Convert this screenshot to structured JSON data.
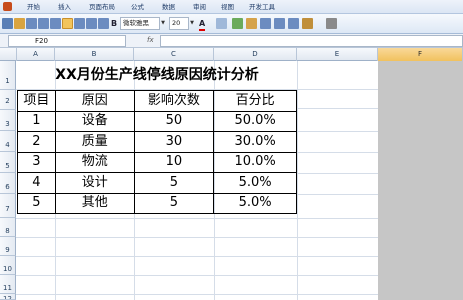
{
  "ribbon": {
    "tabs": [
      "开始",
      "插入",
      "页面布局",
      "公式",
      "数据",
      "审阅",
      "视图",
      "开发工具"
    ]
  },
  "toolbar": {
    "bold_label": "B",
    "font_name": "微软雅黑",
    "font_size": "20",
    "font_color_label": "A"
  },
  "formula_bar": {
    "cell_reference": "F20",
    "fx_label": "fx",
    "formula_value": ""
  },
  "sheet": {
    "columns": [
      "A",
      "B",
      "C",
      "D",
      "E",
      "F"
    ],
    "rows": [
      "1",
      "2",
      "3",
      "4",
      "5",
      "6",
      "7",
      "8",
      "9",
      "10",
      "11",
      "12"
    ],
    "selected_column": "F"
  },
  "table": {
    "title": "XX月份生产线停线原因统计分析",
    "headers": [
      "项目",
      "原因",
      "影响次数",
      "百分比"
    ],
    "rows": [
      [
        "1",
        "设备",
        "50",
        "50.0%"
      ],
      [
        "2",
        "质量",
        "30",
        "30.0%"
      ],
      [
        "3",
        "物流",
        "10",
        "10.0%"
      ],
      [
        "4",
        "设计",
        "5",
        "5.0%"
      ],
      [
        "5",
        "其他",
        "5",
        "5.0%"
      ]
    ]
  }
}
